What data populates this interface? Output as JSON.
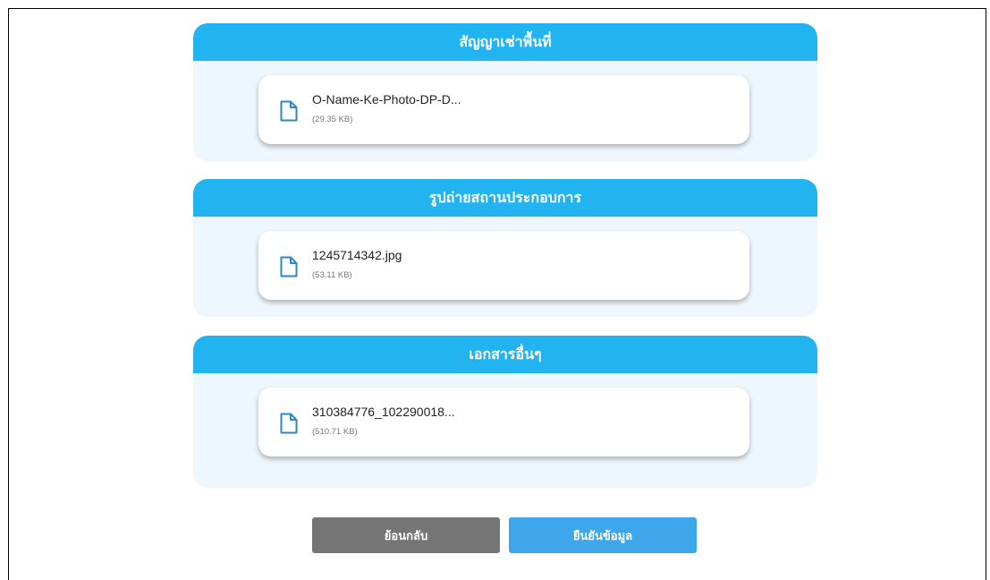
{
  "sections": [
    {
      "title": "สัญญาเช่าพื้นที่",
      "file": {
        "name": "O-Name-Ke-Photo-DP-D...",
        "size": "(29.35 KB)"
      }
    },
    {
      "title": "รูปถ่ายสถานประกอบการ",
      "file": {
        "name": "1245714342.jpg",
        "size": "(53.11 KB)"
      }
    },
    {
      "title": "เอกสารอื่นๆ",
      "file": {
        "name": "310384776_102290018...",
        "size": "(510.71 KB)"
      }
    }
  ],
  "buttons": {
    "back": "ย้อนกลับ",
    "confirm": "ยืนยันข้อมูล"
  },
  "colors": {
    "header": "#21b4f1",
    "section_bg": "#eef7fd",
    "back_button": "#757575",
    "confirm_button": "#3ea6ea",
    "icon": "#2d86c6"
  },
  "icons": {
    "file": "file-icon"
  }
}
